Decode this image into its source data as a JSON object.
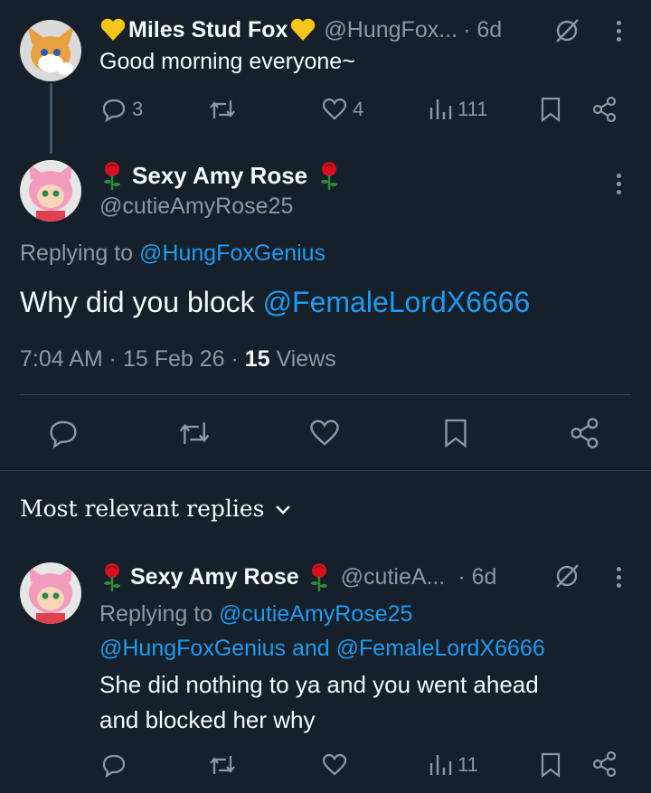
{
  "tweet1": {
    "name": "Miles Stud Fox",
    "handle": "@HungFox...",
    "time": "· 6d",
    "text": "Good morning everyone~",
    "replies": "3",
    "likes": "4",
    "views": "111"
  },
  "tweet2": {
    "name": "Sexy Amy Rose",
    "handle": "@cutieAmyRose25",
    "replying_prefix": "Replying to",
    "replying_to": "@HungFoxGenius",
    "text_prefix": "Why did you block",
    "text_mention": "@FemaleLordX6666",
    "meta_time": "7:04 AM · 15 Feb 26 ·",
    "meta_views_count": "15",
    "meta_views_label": "Views"
  },
  "replies_section": {
    "title": "Most relevant replies"
  },
  "reply1": {
    "name": "Sexy Amy Rose",
    "handle": "@cutieA...",
    "time": "· 6d",
    "replying_prefix": "Replying to",
    "replying_to_1": "@cutieAmyRose25",
    "replying_to_2": "@HungFoxGenius",
    "replying_and": "and",
    "replying_to_3": "@FemaleLordX6666",
    "text_line1": "She did nothing to ya and you went ahead",
    "text_line2": "and blocked her why",
    "views": "11"
  },
  "colors": {
    "background": "#15202b",
    "text": "#f7f9f9",
    "dim": "#8b98a5",
    "link": "#1d9bf0",
    "heart_emoji": "#f5c518",
    "rose_emoji": "#d4111e"
  }
}
